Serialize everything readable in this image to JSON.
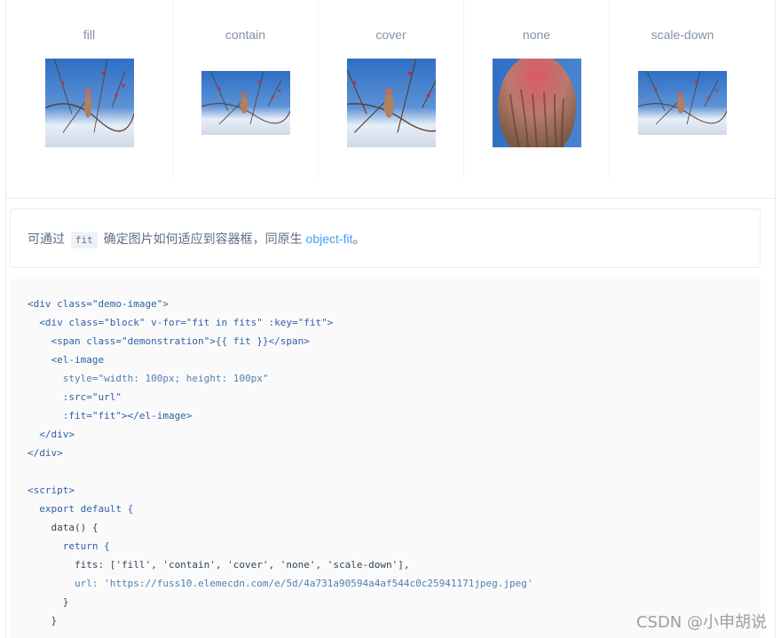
{
  "demo": {
    "blocks": [
      {
        "label": "fill"
      },
      {
        "label": "contain"
      },
      {
        "label": "cover"
      },
      {
        "label": "none"
      },
      {
        "label": "scale-down"
      }
    ]
  },
  "description": {
    "prefix": "可通过 ",
    "code": "fit",
    "middle": " 确定图片如何适应到容器框，同原生 ",
    "link": "object-fit",
    "suffix": "。"
  },
  "code_lines": [
    "<div class=\"demo-image\">",
    "  <div class=\"block\" v-for=\"fit in fits\" :key=\"fit\">",
    "    <span class=\"demonstration\">{{ fit }}</span>",
    "    <el-image",
    "      style=\"width: 100px; height: 100px\"",
    "      :src=\"url\"",
    "      :fit=\"fit\"></el-image>",
    "  </div>",
    "</div>",
    "",
    "<script>",
    "  export default {",
    "    data() {",
    "      return {",
    "        fits: ['fill', 'contain', 'cover', 'none', 'scale-down'],",
    "        url: 'https://fuss10.elemecdn.com/e/5d/4a731a90594a4af544c0c25941171jpeg.jpeg'",
    "      }",
    "    }"
  ],
  "watermark": "CSDN @小申胡说"
}
